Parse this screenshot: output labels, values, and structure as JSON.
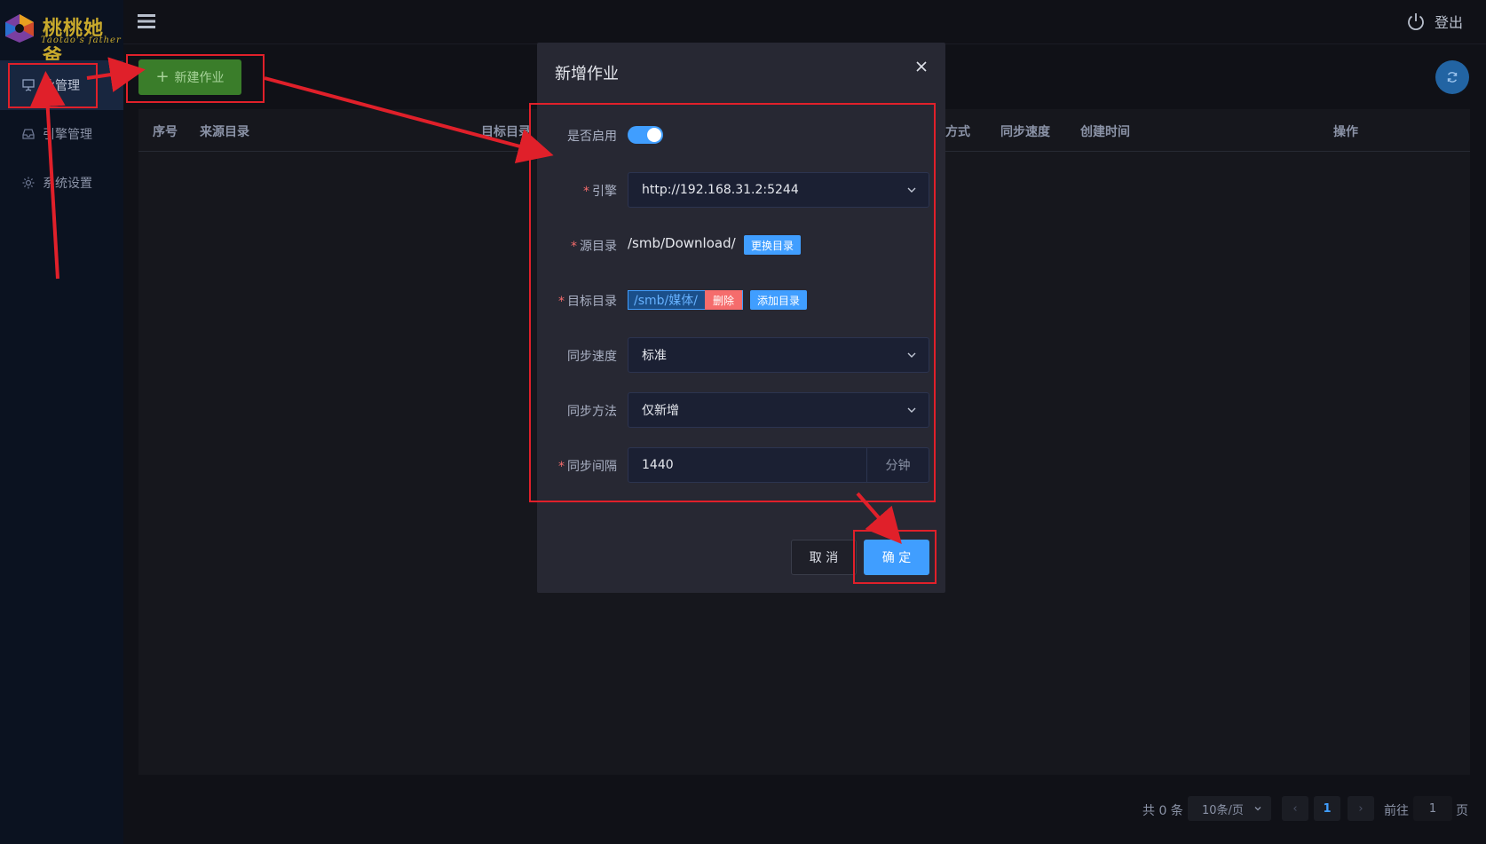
{
  "logo": {
    "title": "桃桃她爸",
    "subtitle": "Taotao's father"
  },
  "sidebar": {
    "items": [
      {
        "label": "业管理",
        "icon": "presentation-icon",
        "active": true
      },
      {
        "label": "引擎管理",
        "icon": "inbox-icon",
        "active": false
      },
      {
        "label": "系统设置",
        "icon": "gear-icon",
        "active": false
      }
    ]
  },
  "header": {
    "logout_label": "登出"
  },
  "toolbar": {
    "new_job_label": "新建作业"
  },
  "table": {
    "columns": [
      "序号",
      "来源目录",
      "目标目录",
      "方式",
      "同步速度",
      "创建时间",
      "操作"
    ]
  },
  "pagination": {
    "total": "共 0 条",
    "page_size": "10条/页",
    "current_page": "1",
    "goto_label": "前往",
    "goto_value": "1",
    "page_suffix": "页"
  },
  "modal": {
    "title": "新增作业",
    "enable_label": "是否启用",
    "enabled": true,
    "engine_label": "引擎",
    "engine_value": "http://192.168.31.2:5244",
    "source_label": "源目录",
    "source_value": "/smb/Download/",
    "change_dir_label": "更换目录",
    "target_label": "目标目录",
    "target_value": "/smb/媒体/",
    "delete_label": "删除",
    "add_dir_label": "添加目录",
    "speed_label": "同步速度",
    "speed_value": "标准",
    "method_label": "同步方法",
    "method_value": "仅新增",
    "interval_label": "同步间隔",
    "interval_value": "1440",
    "interval_unit": "分钟",
    "cancel_label": "取 消",
    "confirm_label": "确 定"
  },
  "colors": {
    "accent": "#409eff",
    "annotation": "#e0202a",
    "new_button": "#3a7d2a",
    "danger": "#f56c6c"
  }
}
